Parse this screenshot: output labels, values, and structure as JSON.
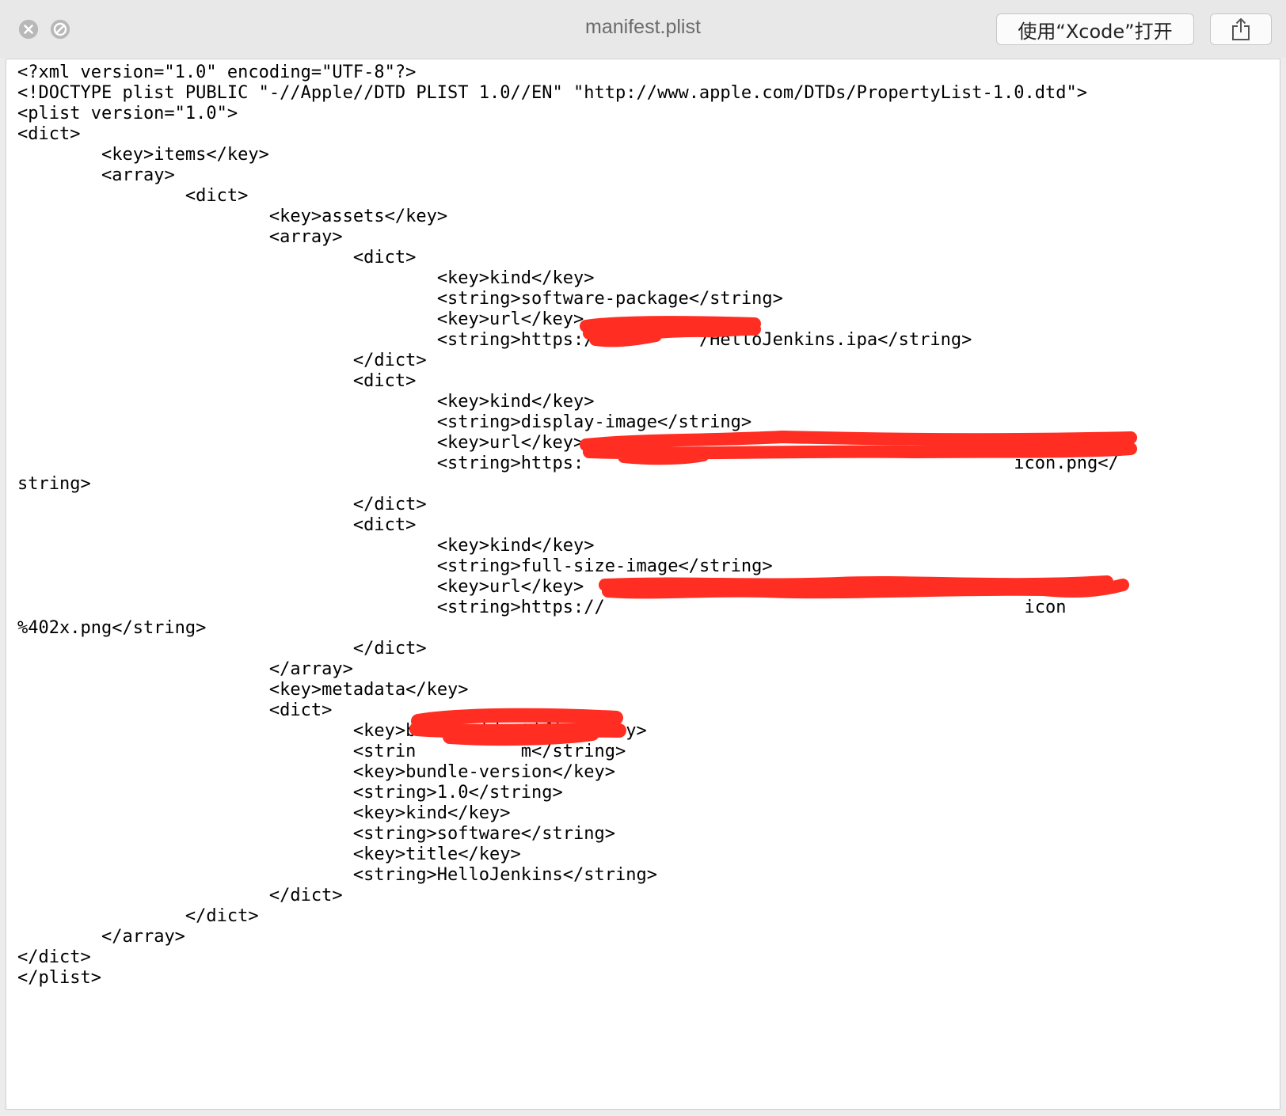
{
  "window": {
    "title": "manifest.plist",
    "open_button_label": "使用“Xcode”打开",
    "close_icon": "close-icon",
    "minimize_icon": "minimize-icon",
    "share_icon": "share-icon"
  },
  "colors": {
    "redaction": "#ff2d22",
    "titlebar": "#e8e8e8",
    "traffic_light": "#b8b8b8"
  },
  "code_lines": [
    "<?xml version=\"1.0\" encoding=\"UTF-8\"?>",
    "<!DOCTYPE plist PUBLIC \"-//Apple//DTD PLIST 1.0//EN\" \"http://www.apple.com/DTDs/PropertyList-1.0.dtd\">",
    "<plist version=\"1.0\">",
    "<dict>",
    "\t<key>items</key>",
    "\t<array>",
    "\t\t<dict>",
    "\t\t\t<key>assets</key>",
    "\t\t\t<array>",
    "\t\t\t\t<dict>",
    "\t\t\t\t\t<key>kind</key>",
    "\t\t\t\t\t<string>software-package</string>",
    "\t\t\t\t\t<key>url</key>",
    "\t\t\t\t\t<string>https:/██████████/HelloJenkins.ipa</string>",
    "\t\t\t\t</dict>",
    "\t\t\t\t<dict>",
    "\t\t\t\t\t<key>kind</key>",
    "\t\t\t\t\t<string>display-image</string>",
    "\t\t\t\t\t<key>url</key>",
    "\t\t\t\t\t<string>https:█████████████████████████████████████████icon.png</",
    "string>",
    "\t\t\t\t</dict>",
    "\t\t\t\t<dict>",
    "\t\t\t\t\t<key>kind</key>",
    "\t\t\t\t\t<string>full-size-image</string>",
    "\t\t\t\t\t<key>url</key>",
    "\t\t\t\t\t<string>https://████████████████████████████████████████icon",
    "%402x.png</string>",
    "\t\t\t\t</dict>",
    "\t\t\t</array>",
    "\t\t\t<key>metadata</key>",
    "\t\t\t<dict>",
    "\t\t\t\t<key>bundle-identifier</key>",
    "\t\t\t\t<strin██████████m</string>",
    "\t\t\t\t<key>bundle-version</key>",
    "\t\t\t\t<string>1.0</string>",
    "\t\t\t\t<key>kind</key>",
    "\t\t\t\t<string>software</string>",
    "\t\t\t\t<key>title</key>",
    "\t\t\t\t<string>HelloJenkins</string>",
    "\t\t\t</dict>",
    "\t\t</dict>",
    "\t</array>",
    "</dict>",
    "</plist>"
  ]
}
